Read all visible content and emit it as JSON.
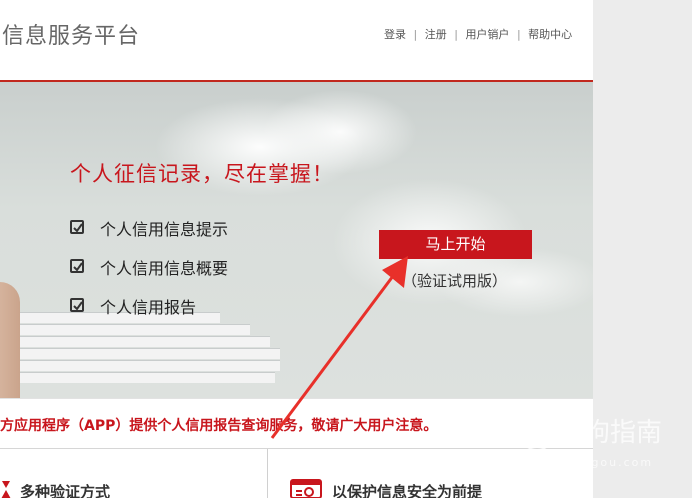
{
  "header": {
    "site_title": "信息服务平台",
    "nav": [
      "登录",
      "注册",
      "用户销户",
      "帮助中心"
    ],
    "separator": "|"
  },
  "banner": {
    "headline": "个人征信记录，尽在掌握！",
    "features": [
      "个人信用信息提示",
      "个人信用信息概要",
      "个人信用报告"
    ],
    "start_button": "马上开始",
    "trial_note": "（验证试用版）"
  },
  "notice": {
    "text": "方应用程序（APP）提供个人信用报告查询服务，敬请广大用户注意。"
  },
  "feature_boxes": [
    {
      "label": "多种验证方式",
      "icon": "verify-icon"
    },
    {
      "label": "以保护信息安全为前提",
      "icon": "security-icon"
    }
  ],
  "watermark": {
    "text": "搜狗指南",
    "sub": "zhinan.sogou.com"
  },
  "colors": {
    "accent": "#c8161d",
    "header_line": "#c1281e",
    "arrow": "#e8302a"
  }
}
